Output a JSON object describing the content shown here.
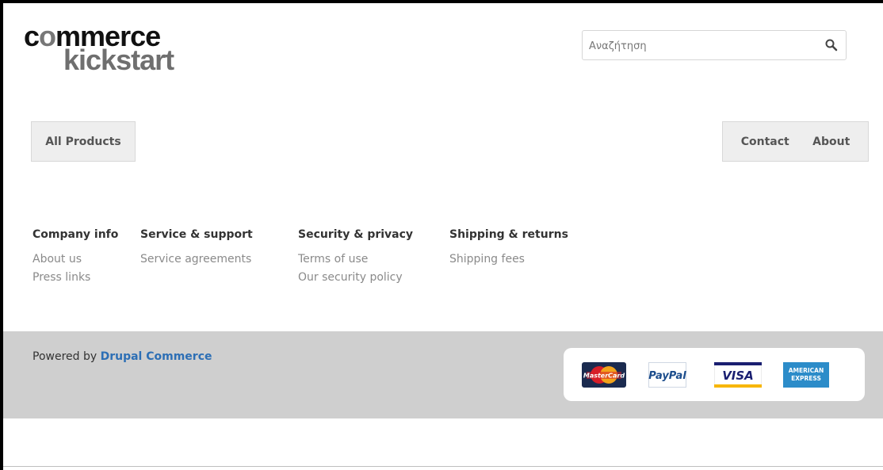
{
  "logo": {
    "line1_pre": "c",
    "line1_o": "o",
    "line1_post": "mmerce",
    "line2": "kickstart"
  },
  "search": {
    "placeholder": "Αναζήτηση",
    "value": ""
  },
  "nav": {
    "left": [
      {
        "label": "All Products"
      }
    ],
    "right": [
      {
        "label": "Contact"
      },
      {
        "label": "About"
      }
    ]
  },
  "footer_menu": [
    {
      "title": "Company info",
      "links": [
        "About us",
        "Press links"
      ]
    },
    {
      "title": "Service & support",
      "links": [
        "Service agreements"
      ]
    },
    {
      "title": "Security & privacy",
      "links": [
        "Terms of use",
        "Our security policy"
      ]
    },
    {
      "title": "Shipping & returns",
      "links": [
        "Shipping fees"
      ]
    }
  ],
  "powered": {
    "prefix": "Powered by ",
    "link": "Drupal Commerce"
  },
  "payment_cards": [
    {
      "name": "mastercard-icon",
      "text": "MasterCard"
    },
    {
      "name": "paypal-icon",
      "text": "PayPal"
    },
    {
      "name": "visa-icon",
      "text": "VISA"
    },
    {
      "name": "amex-icon",
      "text_top": "AMERICAN",
      "text_bottom": "EXPRESS"
    }
  ],
  "colors": {
    "link_blue": "#2d6fb5",
    "band_gray": "#cfcfcf",
    "nav_gray": "#eeeeee"
  }
}
